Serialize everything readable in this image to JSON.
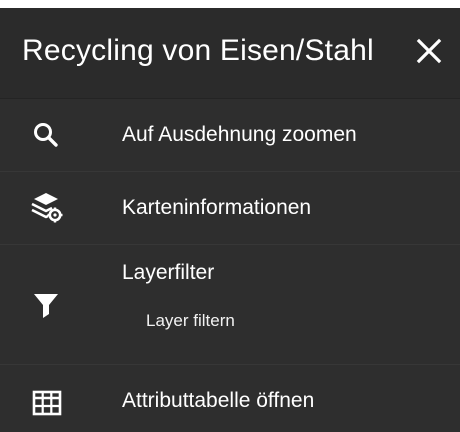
{
  "header": {
    "title": "Recycling von Eisen/Stahl",
    "close_icon": "close-icon"
  },
  "menu": {
    "items": [
      {
        "label": "Auf Ausdehnung zoomen",
        "icon": "search-icon"
      },
      {
        "label": "Karteninformationen",
        "icon": "layers-settings-icon"
      },
      {
        "label": "Layerfilter",
        "icon": "filter-icon",
        "sub_label": "Layer filtern"
      },
      {
        "label": "Attributtabelle öffnen",
        "icon": "table-icon"
      }
    ]
  },
  "colors": {
    "panel_background": "#2a2a2a",
    "text": "#ffffff",
    "separator": "#373737"
  }
}
